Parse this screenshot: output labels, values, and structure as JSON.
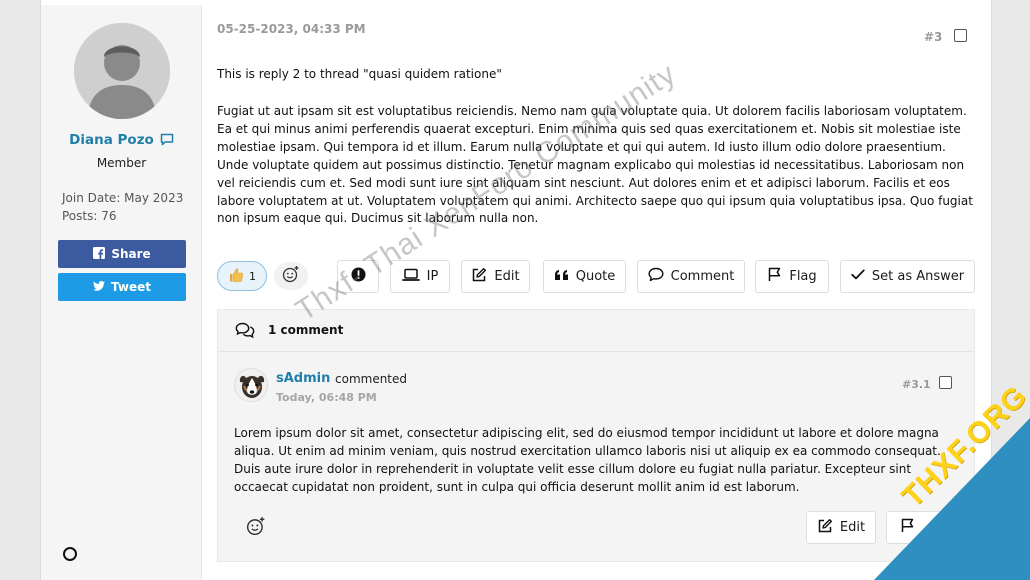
{
  "user": {
    "name": "Diana Pozo",
    "title": "Member",
    "join_date": "Join Date: May 2023",
    "posts": "Posts: 76",
    "share_label": "Share",
    "tweet_label": "Tweet"
  },
  "post": {
    "date": "05-25-2023, 04:33 PM",
    "number": "#3",
    "title": "This is reply 2 to thread \"quasi quidem ratione\"",
    "body": "Fugiat ut aut ipsam sit est voluptatibus reiciendis. Nemo nam quia voluptate quia. Ut dolorem facilis laboriosam voluptatem. Ea et qui minus animi perferendis quaerat excepturi. Enim minima quis sed quas exercitationem et. Nobis sit molestiae iste molestiae ipsam. Qui tempora id et illum. Earum nulla voluptate et qui qui autem. Id iusto illum odio dolore praesentium. Unde voluptate quidem aut possimus distinctio. Tenetur magnam explicabo qui molestias id necessitatibus. Laboriosam non vel reiciendis cum et. Sed modi sunt iure sint aliquam sint nesciunt. Aut dolores enim et et adipisci laborum. Facilis et eos labore voluptatem at ut. Voluptatem voluptatem qui animi. Architecto saepe quo qui ipsum quia voluptatibus ipsa. Quo fugiat non ipsum eaque qui. Ducimus sit laborum nulla non.",
    "reaction_count": "1",
    "actions": {
      "ip": "IP",
      "edit": "Edit",
      "quote": "Quote",
      "comment": "Comment",
      "flag": "Flag",
      "answer": "Set as Answer"
    }
  },
  "comments": {
    "header": "1 comment",
    "items": [
      {
        "author": "sAdmin",
        "verb": "commented",
        "time": "Today, 06:48 PM",
        "number": "#3.1",
        "body": "Lorem ipsum dolor sit amet, consectetur adipiscing elit, sed do eiusmod tempor incididunt ut labore et dolore magna aliqua. Ut enim ad minim veniam, quis nostrud exercitation ullamco laboris nisi ut aliquip ex ea commodo consequat. Duis aute irure dolor in reprehenderit in voluptate velit esse cillum dolore eu fugiat nulla pariatur. Excepteur sint occaecat cupidatat non proident, sunt in culpa qui officia deserunt mollit anim id est laborum.",
        "edit_label": "Edit"
      }
    ]
  },
  "watermark": "Thxf- Thai XenForo Community",
  "badge": "THXF.ORG",
  "colors": {
    "link": "#1f7fa8",
    "facebook": "#3b5aa0",
    "twitter": "#1d9be6",
    "badge": "#2f8fc0",
    "badge_text": "#ffd21a"
  }
}
